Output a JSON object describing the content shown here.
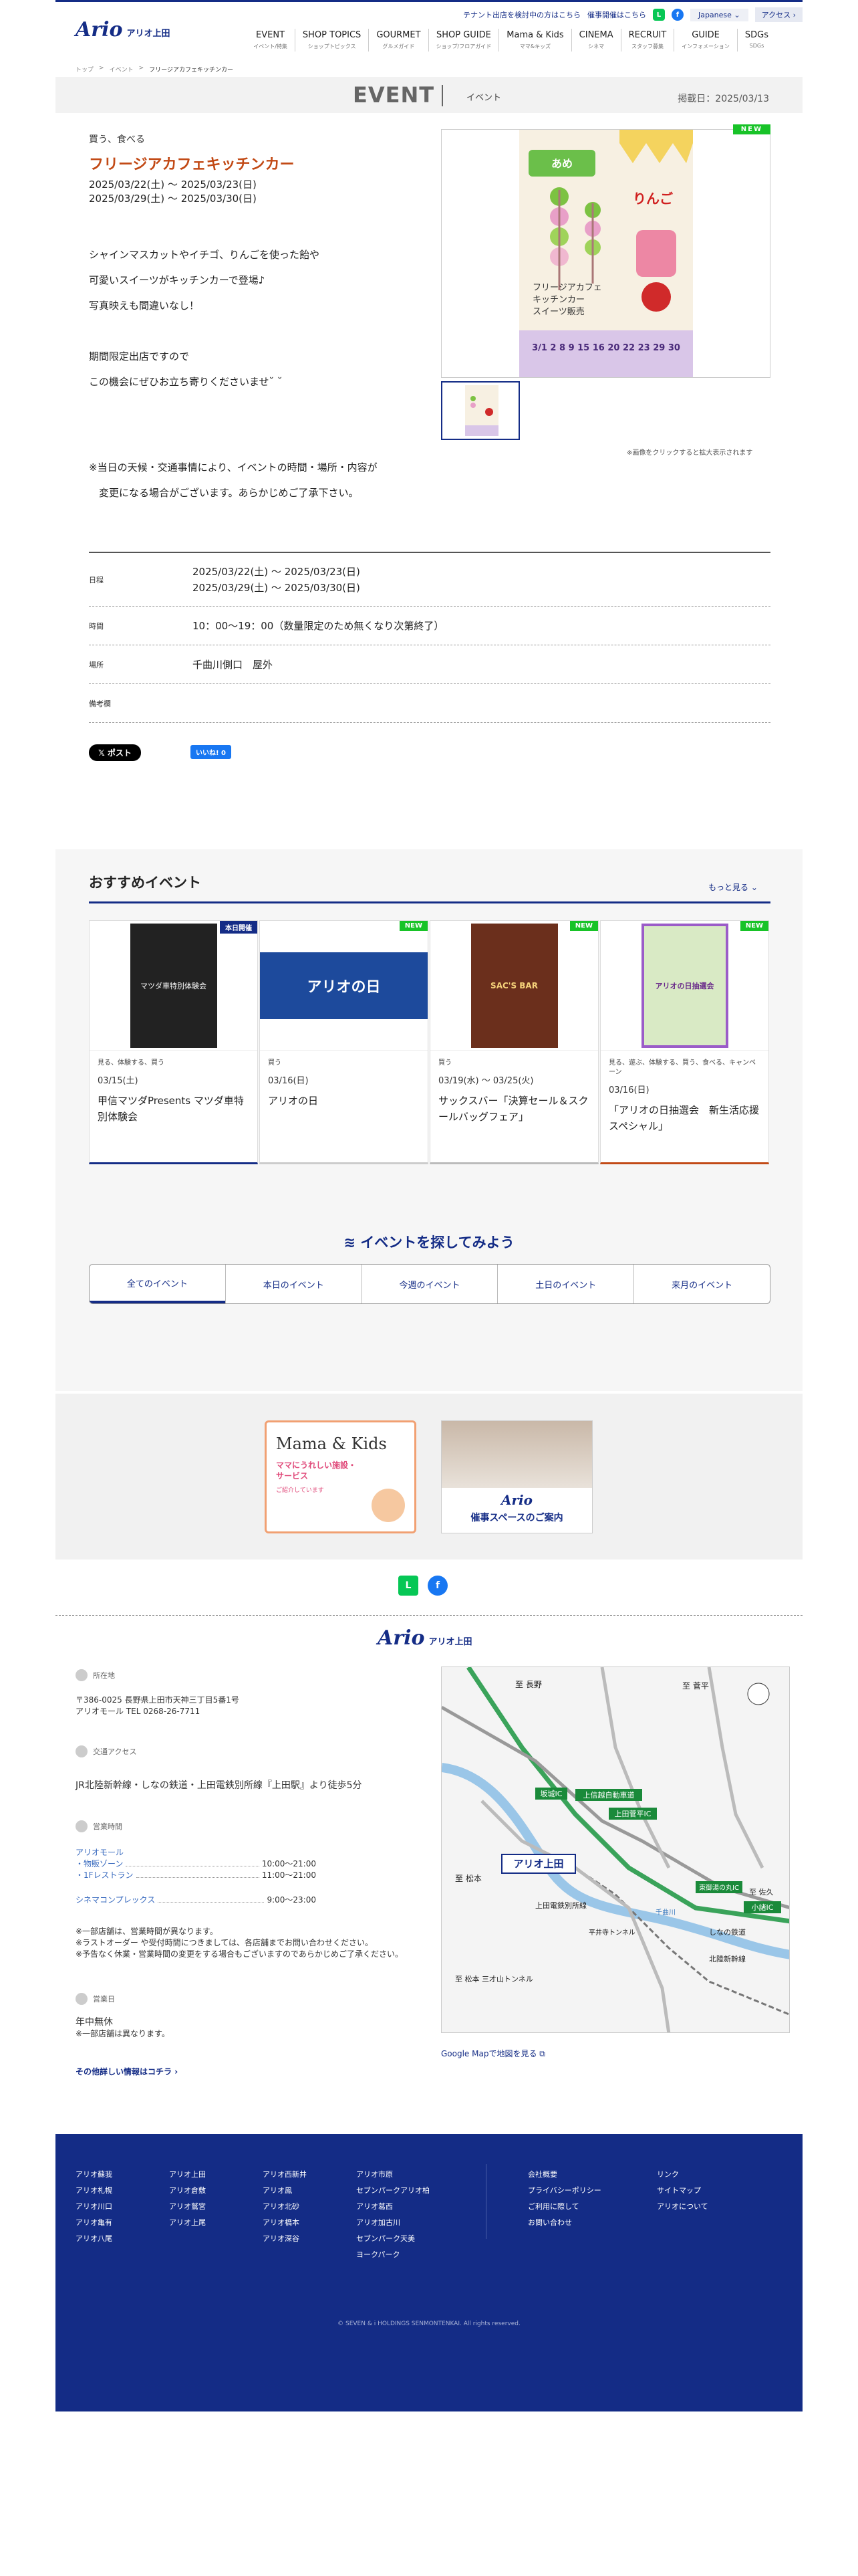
{
  "header": {
    "logo": "Ario",
    "logo_sub": "アリオ上田",
    "top_links": [
      "テナント出店を検討中の方はこちら",
      "催事開催はこちら"
    ],
    "language": "Japanese",
    "access": "アクセス",
    "nav": [
      {
        "main": "EVENT",
        "sub": "イベント/特集"
      },
      {
        "main": "SHOP TOPICS",
        "sub": "ショップトピックス"
      },
      {
        "main": "GOURMET",
        "sub": "グルメガイド"
      },
      {
        "main": "SHOP GUIDE",
        "sub": "ショップ/フロアガイド"
      },
      {
        "main": "Mama & Kids",
        "sub": "ママ&キッズ"
      },
      {
        "main": "CINEMA",
        "sub": "シネマ"
      },
      {
        "main": "RECRUIT",
        "sub": "スタッフ募集"
      },
      {
        "main": "GUIDE",
        "sub": "インフォメーション"
      },
      {
        "main": "SDGs",
        "sub": "SDGs"
      }
    ]
  },
  "breadcrumb": [
    "トップ",
    "イベント",
    "フリージアカフェキッチンカー"
  ],
  "title_band": {
    "main": "EVENT",
    "sub": "イベント",
    "posted": "掲載日：2025/03/13"
  },
  "event": {
    "category": "買う、食べる",
    "title": "フリージアカフェキッチンカー",
    "dates": [
      "2025/03/22(土) 〜 2025/03/23(日)",
      "2025/03/29(土) 〜 2025/03/30(日)"
    ],
    "description": [
      "シャインマスカットやイチゴ、りんごを使った飴や",
      "可愛いスイーツがキッチンカーで登場♪",
      "写真映えも間違いなし！",
      "",
      "期間限定出店ですので",
      "この機会にぜひお立ち寄りくださいませ˘ ˘"
    ],
    "notice": [
      "※当日の天候・交通事情により、イベントの時間・場所・内容が",
      "　変更になる場合がございます。あらかじめご了承下さい。"
    ],
    "badge": "NEW",
    "image_note": "※画像をクリックすると拡大表示されます",
    "poster_text": [
      "フリージアカフェ",
      "キッチンカー",
      "スイーツ販売",
      "りんご飴"
    ],
    "poster_dates": "3/1 2 8 9 15 16 20 22 23 29 30"
  },
  "info_table": [
    {
      "label": "日程",
      "value": [
        "2025/03/22(土) 〜 2025/03/23(日)",
        "2025/03/29(土) 〜 2025/03/30(日)"
      ]
    },
    {
      "label": "時間",
      "value": [
        "10：00〜19：00（数量限定のため無くなり次第終了）"
      ]
    },
    {
      "label": "場所",
      "value": [
        "千曲川側口　屋外"
      ]
    },
    {
      "label": "備考欄",
      "value": [
        ""
      ]
    }
  ],
  "share": {
    "x": "ポスト",
    "fb": "いいね! 0"
  },
  "recommend": {
    "title": "おすすめイベント",
    "more": "もっと見る",
    "cards": [
      {
        "badge": "本日開催",
        "badge_color": "#142c86",
        "category": "見る、体験する、買う",
        "date": "03/15(土)",
        "title": "甲信マツダPresents マツダ車特別体験会",
        "img_text": "マツダ車特別体験会"
      },
      {
        "badge": "NEW",
        "badge_color": "#18c328",
        "category": "買う",
        "date": "03/16(日)",
        "title": "アリオの日",
        "img_text": "アリオの日"
      },
      {
        "badge": "NEW",
        "badge_color": "#18c328",
        "category": "買う",
        "date": "03/19(水) 〜 03/25(火)",
        "title": "サックスバー「決算セール＆スクールバッグフェア」",
        "img_text": "SAC'S BAR"
      },
      {
        "badge": "NEW",
        "badge_color": "#18c328",
        "category": "見る、遊ぶ、体験する、買う、食べる、キャンペーン",
        "date": "03/16(日)",
        "title": "「アリオの日抽選会　新生活応援スペシャル」",
        "img_text": "アリオの日抽選会"
      }
    ]
  },
  "search": {
    "title": "イベントを探してみよう",
    "tabs": [
      "全てのイベント",
      "本日のイベント",
      "今週のイベント",
      "土日のイベント",
      "来月のイベント"
    ]
  },
  "banners": {
    "mama_kids": {
      "line1": "Mama & Kids",
      "line2": "ママにうれしい施設・サービス",
      "line3": "ご紹介しています"
    },
    "event_space": {
      "logo": "Ario",
      "text": "催事スペースのご案内"
    }
  },
  "footer_info": {
    "address_head": "所在地",
    "address": [
      "〒386-0025 長野県上田市天神三丁目5番1号",
      "アリオモール TEL 0268-26-7711"
    ],
    "access_head": "交通アクセス",
    "access": "JR北陸新幹線・しなの鉄道・上田電鉄別所線『上田駅』より徒歩5分",
    "hours_head": "営業時間",
    "hours": [
      {
        "name": "アリオモール",
        "time": ""
      },
      {
        "name": "・物販ゾーン",
        "time": "10:00〜21:00"
      },
      {
        "name": "・1Fレストラン",
        "time": "11:00〜21:00"
      },
      {
        "name": "シネマコンプレックス",
        "time": "9:00〜23:00"
      }
    ],
    "hours_notes": [
      "※一部店舗は、営業時間が異なります。",
      "※ラストオーダー や受付時間につきましては、各店舗までお問い合わせください。",
      "※予告なく休業・営業時間の変更をする場合もございますのであらかじめご了承ください。"
    ],
    "holiday_head": "営業日",
    "holiday": [
      "年中無休",
      "※一部店舗は異なります。"
    ],
    "more_link": "その他詳しい情報はコチラ",
    "map_link": "Google Mapで地図を見る",
    "map_labels": [
      "至 長野",
      "至 菅平",
      "上信越自動車道",
      "上田菅平IC",
      "アリオ上田",
      "坂城IC",
      "至 松本",
      "上田電鉄別所線",
      "しなの鉄道",
      "北陸新幹線",
      "小諸IC",
      "至 佐久",
      "至 松本 三才山トンネル",
      "平井寺トンネル",
      "東御湯の丸IC",
      "千曲川"
    ]
  },
  "footer_nav": {
    "col1": [
      "アリオ蘇我",
      "アリオ札幌",
      "アリオ川口",
      "アリオ亀有",
      "アリオ八尾"
    ],
    "col2": [
      "アリオ上田",
      "アリオ倉敷",
      "アリオ鷲宮",
      "アリオ上尾"
    ],
    "col3": [
      "アリオ西新井",
      "アリオ鳳",
      "アリオ北砂",
      "アリオ橋本",
      "アリオ深谷"
    ],
    "col4": [
      "アリオ市原",
      "セブンパークアリオ柏",
      "アリオ葛西",
      "アリオ加古川",
      "セブンパーク天美",
      "ヨークパーク"
    ],
    "col5": [
      "会社概要",
      "プライバシーポリシー",
      "ご利用に際して",
      "お問い合わせ"
    ],
    "col6": [
      "リンク",
      "サイトマップ",
      "アリオについて"
    ],
    "copyright": "© SEVEN & i HOLDINGS SENMONTENKAI. All rights reserved."
  },
  "colors": {
    "brand": "#142c86",
    "accent": "#c24a16",
    "new": "#18c328"
  }
}
